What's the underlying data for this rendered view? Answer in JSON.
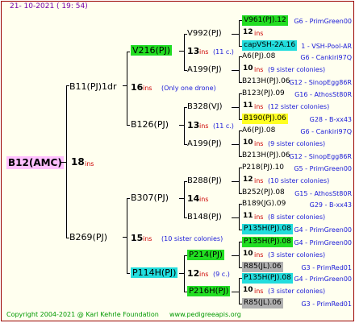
{
  "header": {
    "date": "21- 10-2021 ( 19: 54)"
  },
  "colors": {
    "pink": "#ffc0ff",
    "green": "#22dd22",
    "cyan": "#22dddd",
    "yellow": "#ffff22",
    "gray": "#b0b0b0"
  },
  "root": {
    "name": "B12(AMC)",
    "count": "18",
    "unit": "ins"
  },
  "gen1": [
    {
      "name": "B11(PJ)1dr",
      "count": "16",
      "unit": "ins",
      "note": "(Only one drone)"
    },
    {
      "name": "B269(PJ)",
      "count": "15",
      "unit": "ins",
      "note": "(10 sister colonies)"
    }
  ],
  "gen2": [
    {
      "name": "V216(PJ)",
      "count": "13",
      "unit": "ins",
      "note": "(11 c.)"
    },
    {
      "name": "B126(PJ)",
      "count": "13",
      "unit": "ins",
      "note": "(11 c.)"
    },
    {
      "name": "B307(PJ)",
      "count": "14",
      "unit": "ins",
      "note": ""
    },
    {
      "name": "P114H(PJ)",
      "count": "12",
      "unit": "ins",
      "note": "(9 c.)"
    }
  ],
  "gen3": [
    {
      "name": "V992(PJ)",
      "count": "13",
      "unit": "ins",
      "note": "(11 c.)"
    },
    {
      "name": "A199(PJ)",
      "count": "",
      "unit": "",
      "note": ""
    },
    {
      "name": "B328(VJ)",
      "count": "13",
      "unit": "ins",
      "note": "(11 c.)"
    },
    {
      "name": "A199(PJ)",
      "count": "",
      "unit": "",
      "note": ""
    },
    {
      "name": "B288(PJ)",
      "count": "",
      "unit": "",
      "note": ""
    },
    {
      "name": "B148(PJ)",
      "count": "",
      "unit": "",
      "note": ""
    },
    {
      "name": "P214(PJ)",
      "count": "",
      "unit": "",
      "note": ""
    },
    {
      "name": "P216H(PJ)",
      "count": "",
      "unit": "",
      "note": ""
    }
  ],
  "gen4": [
    {
      "l1": "V961(PJ).12",
      "s1": "G6 - PrimGreen00",
      "count": "12",
      "unit": "ins",
      "note": "",
      "l3": "capVSH-2A.16",
      "s3": "1 - VSH-Pool-AR"
    },
    {
      "l1": "A6(PJ).08",
      "s1": "G6 - Cankiri97Q",
      "count": "10",
      "unit": "ins",
      "note": "(9 sister colonies)",
      "l3": "B213H(PJ).06",
      "s3": "G12 - SinopEgg86R"
    },
    {
      "l1": "B123(PJ).09",
      "s1": "G16 - AthosSt80R",
      "count": "11",
      "unit": "ins",
      "note": "(12 sister colonies)",
      "l3": "B190(PJ).06",
      "s3": "G28 - B-xx43"
    },
    {
      "l1": "A6(PJ).08",
      "s1": "G6 - Cankiri97Q",
      "count": "10",
      "unit": "ins",
      "note": "(9 sister colonies)",
      "l3": "B213H(PJ).06",
      "s3": "G12 - SinopEgg86R"
    },
    {
      "l1": "P218(PJ).10",
      "s1": "G5 - PrimGreen00",
      "count": "12",
      "unit": "ins",
      "note": "(10 sister colonies)",
      "l3": "B252(PJ).08",
      "s3": "G15 - AthosSt80R"
    },
    {
      "l1": "B189(JG).09",
      "s1": "G29 - B-xx43",
      "count": "11",
      "unit": "ins",
      "note": "(8 sister colonies)",
      "l3": "P135H(PJ).08",
      "s3": "G4 - PrimGreen00"
    },
    {
      "l1": "P135H(PJ).08",
      "s1": "G4 - PrimGreen00",
      "count": "10",
      "unit": "ins",
      "note": "(3 sister colonies)",
      "l3": "R85(JL).06",
      "s3": "G3 - PrimRed01"
    },
    {
      "l1": "P135H(PJ).08",
      "s1": "G4 - PrimGreen00",
      "count": "10",
      "unit": "ins",
      "note": "(3 sister colonies)",
      "l3": "R85(JL).06",
      "s3": "G3 - PrimRed01"
    }
  ],
  "footer": {
    "copyright": "Copyright 2004-2021 @ Karl Kehrle Foundation",
    "url": "www.pedigreeapis.org"
  }
}
